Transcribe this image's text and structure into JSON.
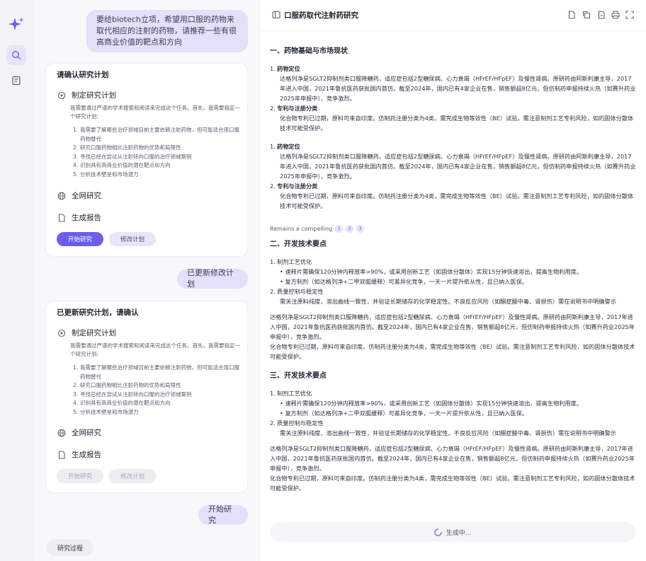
{
  "rail": {
    "accent": "#6c5ee8",
    "icons": [
      "sparkle-logo-icon",
      "search-icon",
      "report-icon"
    ]
  },
  "chat": {
    "user_prompt": "要给biotech立项，希望用口服的药物来取代相应的注射的药物，请推荐一些有很高商业价值的靶点和方向",
    "plan_card_1": {
      "title": "请确认研究计划",
      "step1_label": "制定研究计划",
      "step1_desc": "我需要通过严谨的学术搜索和阅读来完成这个任务。首先，我需要指定一个研究计划:",
      "points": [
        "我需要了解哪些治疗领域目前主要依赖注射药物，但可能适合用口服药物替代",
        "研究口服药物相比注射药物的优势和局限性",
        "寻找已经在尝试从注射转向口服的治疗领域案例",
        "识别具有高商业价值的潜在靶点和方向",
        "分析技术壁垒和市场潜力"
      ],
      "step2_label": "全网研究",
      "step3_label": "生成报告",
      "start_button": "开始研究",
      "edit_button": "修改计划"
    },
    "user_update": "已更新修改计划",
    "plan_card_2": {
      "title": "已更新研究计划，请确认",
      "step1_label": "制定研究计划",
      "step1_desc": "我需要通过严谨的学术搜索和阅读来完成这个任务。首先，我需要指定一个研究计划:",
      "points": [
        "我需要了解哪些治疗领域目前主要依赖注射药物，但可能适合用口服药物替代",
        "研究口服药物相比注射药物的优势和局限性",
        "寻找已经在尝试从注射转向口服的治疗领域案例",
        "识别具有高商业价值的潜在靶点和方向",
        "分析技术壁垒和市场潜力"
      ],
      "step2_label": "全网研究",
      "step3_label": "生成报告",
      "start_button": "开始研究",
      "edit_button": "修改计划"
    },
    "user_start": "开始研究",
    "process_label": "研究过程"
  },
  "doc": {
    "title": "口服药取代注射药研究",
    "header_icons": [
      "file-icon",
      "copy-icon",
      "export-icon",
      "print-icon",
      "fullscreen-icon"
    ],
    "section1": {
      "heading": "一、药物基础与市场现状",
      "block_a": {
        "item1_title": "药物定位",
        "item1_text": "达格列净是SGLT2抑制剂类口服降糖药，适应症包括2型糖尿病、心力衰竭（HFrEF/HFpEF）及慢性肾病。原研药由阿斯利康主导，2017年进入中国，2021年鲁抗医药获批国内首仿。截至2024年，国内已有4家企业在售，销售额超8亿元，但仿制药申报持续火热（如赛升药业2025年申报中），竞争激烈。",
        "item2_title": "专利与注册分类",
        "item2_text": "化合物专利已过期，原料可来自印度。仿制药注册分类为4类，需完成生物等效性（BE）试验。需注意制剂工艺专利风险，如的固体分散体技术可能受保护。"
      },
      "block_b": {
        "item1_title": "药物定位",
        "item1_text": "达格列净是SGLT2抑制剂类口服降糖药，适应症包括2型糖尿病、心力衰竭（HFrEF/HFpEF）及慢性肾病。原研药由阿斯利康主导，2017年进入中国，2021年鲁抗医药获批国内首仿。截至2024年，国内已有4家企业在售，销售额超8亿元，但仿制药申报持续火热（如赛升药业2025年申报中），竞争激烈。",
        "item2_title": "专利与注册分类",
        "item2_text": "化合物专利已过期，原料可来自印度。仿制药注册分类为4类，需完成生物等效性（BE）试验。需注意制剂工艺专利风险，如的固体分散体技术可能受保护。"
      },
      "citation_text": "Remains a compelling",
      "citations": [
        "1",
        "2",
        "3"
      ]
    },
    "section2": {
      "heading": "二、开发技术要点",
      "item1_title": "制剂工艺优化",
      "bullet1": "速释片需确保120分钟内释放率>90%，或采用创新工艺（如固体分散体）实现15分钟快速溶出，提高生物利用度。",
      "bullet2": "复方制剂（如达格列净+二甲双胍缓释）可差异化竞争，一天一片提升依从性，且已纳入医保。",
      "item2_title": "质量控制与稳定性",
      "item2_text": "需关注原料纯度、溶出曲线一致性，并验证长期储存的化学稳定性。不良反应风险（如酮症酸中毒、肾损伤）需在说明书中明确警示",
      "para1": "达格列净是SGLT2抑制剂类口服降糖药，适应症包括2型糖尿病、心力衰竭（HFrEF/HFpEF）及慢性肾病。原研药由阿斯利康主导，2017年进入中国，2021年鲁抗医药获批国内首仿。截至2024年，国内已有4家企业在售，销售额超8亿元，但仿制药申报持续火热（如赛升药业2025年申报中），竞争激烈。",
      "para2": "化合物专利已过期，原料可来自印度。仿制药注册分类为4类，需完成生物等效性（BE）试验。需注意制剂工艺专利风险，如的固体分散体技术可能受保护。"
    },
    "section3": {
      "heading": "三、开发技术要点",
      "item1_title": "制剂工艺优化",
      "bullet1": "速释片需确保120分钟内释放率>90%，或采用创新工艺（如固体分散体）实现15分钟快速溶出，提高生物利用度。",
      "bullet2": "复方制剂（如达格列净+二甲双胍缓释）可差异化竞争，一天一片提升依从性，且已纳入医保。",
      "item2_title": "质量控制与稳定性",
      "item2_text": "需关注原料纯度、溶出曲线一致性，并验证长期储存的化学稳定性。不良反应风险（如酮症酸中毒、肾损伤）需在说明书中明确警示",
      "para1": "达格列净是SGLT2抑制剂类口服降糖药，适应症包括2型糖尿病、心力衰竭（HFrEF/HFpEF）及慢性肾病。原研药由阿斯利康主导，2017年进入中国，2021年鲁抗医药获批国内首仿。截至2024年，国内已有4家企业在售，销售额超8亿元，但仿制药申报持续火热（如赛升药业2025年申报中），竞争激烈。",
      "para2": "化合物专利已过期，原料可来自印度。仿制药注册分类为4类，需完成生物等效性（BE）试验。需注意制剂工艺专利风险，如的固体分散体技术可能受保护。"
    },
    "generating_label": "生成中..."
  }
}
